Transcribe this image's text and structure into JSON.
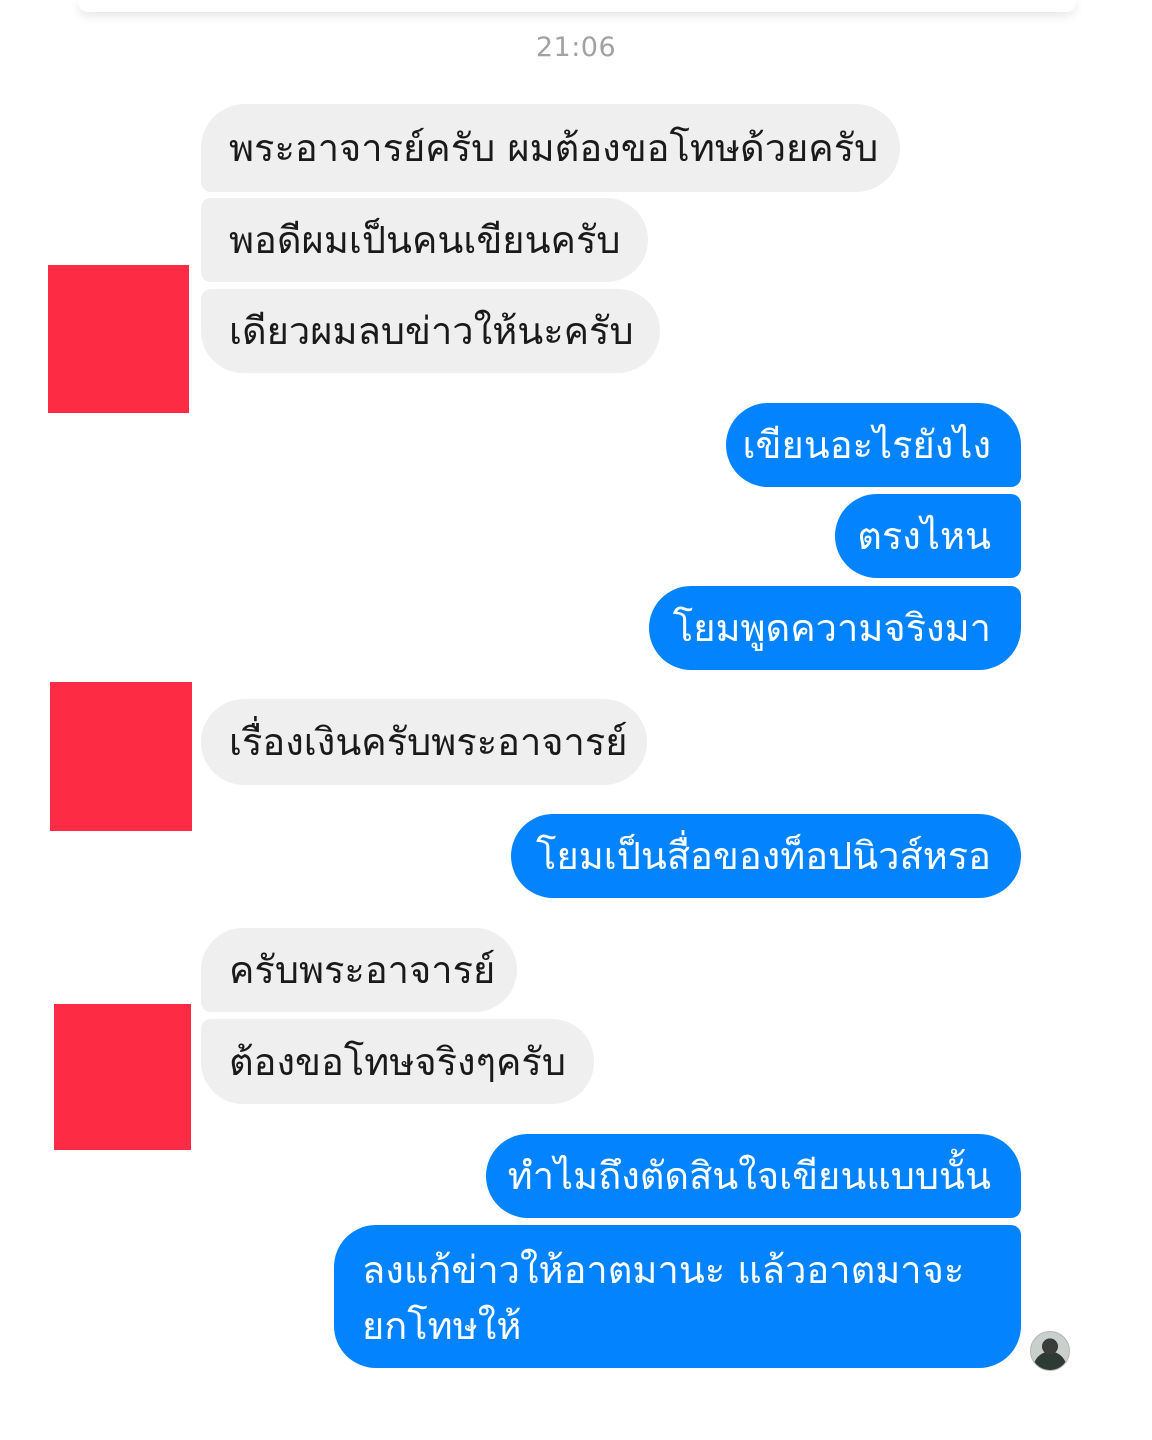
{
  "header": {
    "timestamp": "21:06"
  },
  "messages": [
    {
      "from": "other",
      "text": "พระอาจารย์ครับ ผมต้องขอโทษด้วยครับ"
    },
    {
      "from": "other",
      "text": "พอดีผมเป็นคนเขียนครับ"
    },
    {
      "from": "other",
      "text": "เดียวผมลบข่าวให้นะครับ"
    },
    {
      "from": "me",
      "text": "เขียนอะไรยังไง"
    },
    {
      "from": "me",
      "text": "ตรงไหน"
    },
    {
      "from": "me",
      "text": "โยมพูดความจริงมา"
    },
    {
      "from": "other",
      "text": "เรื่องเงินครับพระอาจารย์"
    },
    {
      "from": "me",
      "text": "โยมเป็นสื่อของท็อปนิวส์หรอ"
    },
    {
      "from": "other",
      "text": "ครับพระอาจารย์"
    },
    {
      "from": "other",
      "text": "ต้องขอโทษจริงๆครับ"
    },
    {
      "from": "me",
      "text": "ทำไมถึงตัดสินใจเขียนแบบนั้น"
    },
    {
      "from": "me",
      "text": "ลงแก้ข่าวให้อาตมานะ แล้วอาตมาจะยกโทษให้"
    }
  ],
  "colors": {
    "incoming_bubble": "#efefef",
    "outgoing_bubble": "#0384fe",
    "redaction": "#fd2b43",
    "timestamp": "#a2a2a2"
  },
  "icons": {
    "seen_avatar": "avatar-photo"
  }
}
